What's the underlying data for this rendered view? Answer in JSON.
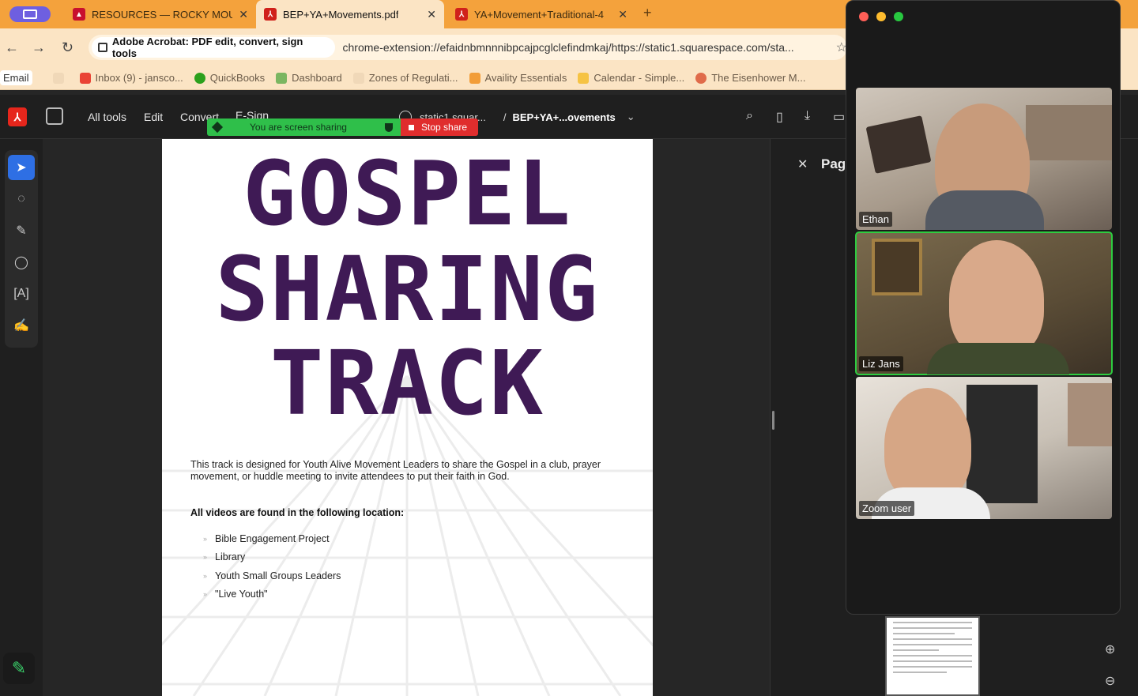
{
  "browser": {
    "tabs": [
      {
        "label": "RESOURCES — ROCKY MOUN",
        "active": false
      },
      {
        "label": "BEP+YA+Movements.pdf",
        "active": true
      },
      {
        "label": "YA+Movement+Traditional-4",
        "active": false
      }
    ],
    "address": {
      "extension_label": "Adobe Acrobat: PDF edit, convert, sign tools",
      "url": "chrome-extension://efaidnbmnnnibpcajpcglclefindmkaj/https://static1.squarespace.com/sta..."
    },
    "bookmarks": [
      {
        "label": "Email",
        "color": "#ffffff"
      },
      {
        "label": "Inbox (9) - jansco...",
        "color": "#ea4335"
      },
      {
        "label": "QuickBooks",
        "color": "#2ca01c"
      },
      {
        "label": "Dashboard",
        "color": "#7bb661"
      },
      {
        "label": "Zones of Regulati...",
        "color": "#f0d8b8"
      },
      {
        "label": "Availity Essentials",
        "color": "#f29d38"
      },
      {
        "label": "Calendar - Simple...",
        "color": "#f6c343"
      },
      {
        "label": "The Eisenhower M...",
        "color": "#e06b4a"
      }
    ]
  },
  "acrobat": {
    "menu": [
      "All tools",
      "Edit",
      "Convert",
      "E-Sign"
    ],
    "doc_host": "static1.squar...",
    "doc_sep": "/",
    "doc_name": "BEP+YA+...ovements",
    "panel_title": "Pag"
  },
  "share_banner": {
    "status": "You are screen sharing",
    "stop": "Stop share"
  },
  "pdf": {
    "title_lines": [
      "GOSPEL",
      "SHARING",
      "TRACK"
    ],
    "intro": "This track is designed for Youth Alive Movement Leaders to share the Gospel in a club, prayer movement, or huddle meeting to invite attendees to put their faith in God.",
    "videos_heading": "All videos are found in the following location:",
    "videos_list": [
      "Bible Engagement Project",
      "Library",
      "Youth Small Groups Leaders",
      "\"Live Youth\""
    ],
    "title_color": "#3f1a55"
  },
  "zoom": {
    "participants": [
      {
        "name": "Ethan",
        "speaking": false
      },
      {
        "name": "Liz Jans",
        "speaking": true
      },
      {
        "name": "Zoom user",
        "speaking": false
      }
    ]
  }
}
